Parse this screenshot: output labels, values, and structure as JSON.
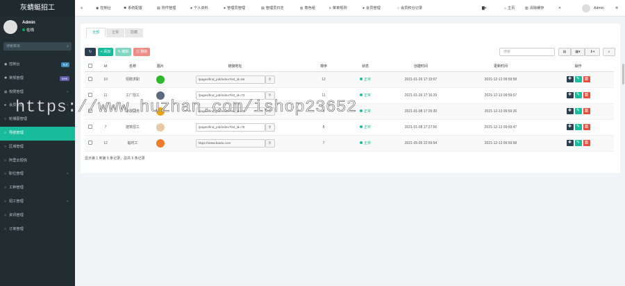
{
  "app": {
    "title": "灰蜻蜓招工"
  },
  "user": {
    "name": "Admin",
    "status": "在线"
  },
  "search": {
    "placeholder": "搜索菜单"
  },
  "sidebar": {
    "items": [
      {
        "label": "控制台",
        "icon": "dashboard-icon",
        "badge": "hot",
        "badge_color": "#3c8dbc"
      },
      {
        "label": "常规管理",
        "icon": "cogs-icon",
        "badge": "new",
        "badge_color": "#605ca8"
      },
      {
        "label": "权限管理",
        "icon": "group-icon",
        "arrow": "‹"
      },
      {
        "label": "会员管理",
        "icon": "user-icon",
        "arrow": "‹"
      },
      {
        "label": "轮播图管理",
        "icon": "image-icon"
      },
      {
        "label": "导航管理",
        "icon": "circle-icon",
        "active": true
      },
      {
        "label": "区域管理",
        "icon": "circle-icon"
      },
      {
        "label": "阿里云短信",
        "icon": "circle-icon"
      },
      {
        "label": "职位管理",
        "icon": "circle-icon",
        "arrow": "‹"
      },
      {
        "label": "工种管理",
        "icon": "circle-icon"
      },
      {
        "label": "招工管理",
        "icon": "circle-icon",
        "arrow": "‹"
      },
      {
        "label": "资讯管理",
        "icon": "circle-icon"
      },
      {
        "label": "订单管理",
        "icon": "circle-icon"
      }
    ]
  },
  "topnav": {
    "items": [
      {
        "label": "控制台",
        "icon": "dashboard-icon"
      },
      {
        "label": "系统配置",
        "icon": "cog-icon"
      },
      {
        "label": "附件管理",
        "icon": "file-icon"
      },
      {
        "label": "个人资料",
        "icon": "user-icon"
      },
      {
        "label": "管理员管理",
        "icon": "user-icon"
      },
      {
        "label": "管理员日志",
        "icon": "list-icon"
      },
      {
        "label": "角色组",
        "icon": "group-icon"
      },
      {
        "label": "菜单规则",
        "icon": "bars-icon"
      },
      {
        "label": "会员管理",
        "icon": "user-icon"
      },
      {
        "label": "会员积分记录",
        "icon": "circle-icon"
      }
    ],
    "right": {
      "home": "主页",
      "clear": "清除缓存",
      "admin": "Admin"
    }
  },
  "tabs": [
    "全部",
    "正常",
    "隐藏"
  ],
  "toolbar": {
    "add": "添加",
    "edit": "编辑",
    "delete": "删除",
    "search_placeholder": "搜索"
  },
  "table": {
    "headers": [
      "Id",
      "名称",
      "图片",
      "链接地址",
      "排序",
      "状态",
      "创建时间",
      "更新时间",
      "操作"
    ],
    "rows": [
      {
        "id": "10",
        "name": "招聘求职",
        "pic_color": "#2eb82e",
        "url": "/pages/find_job/index?list_id=55",
        "sort": "12",
        "status": "正常",
        "created": "2021-01-26 17:15:07",
        "updated": "2021-12-13 09:59:58"
      },
      {
        "id": "11",
        "name": "工厂招工",
        "pic_color": "#5a6b7d",
        "url": "/pages/find_job/index?list_id=73",
        "sort": "11",
        "status": "正常",
        "created": "2021-01-26 17:16:29",
        "updated": "2021-12-13 09:59:07"
      },
      {
        "id": "3",
        "name": "家政服务",
        "pic_color": "#e8a417",
        "url": "/pages/find_job/index?list_id=72",
        "sort": "9",
        "status": "正常",
        "created": "2021-01-08 17:26:30",
        "updated": "2021-12-13 09:59:26"
      },
      {
        "id": "7",
        "name": "建筑招工",
        "pic_color": "#e9c9a7",
        "url": "/pages/find_job/index?list_id=75",
        "sort": "8",
        "status": "正常",
        "created": "2021-01-08 17:27:56",
        "updated": "2021-12-13 09:59:47"
      },
      {
        "id": "12",
        "name": "临时工",
        "pic_color": "#f07d2e",
        "url": "https://www.baidu.com",
        "sort": "7",
        "status": "正常",
        "created": "2021-05-05 22:59:54",
        "updated": "2021-12-13 09:59:58"
      }
    ]
  },
  "footer": {
    "summary": "显示第 1 到第 5 条记录，总共 5 条记录"
  },
  "watermark": "https://www.huzhan.com/ishop23652",
  "colors": {
    "accent": "#18bc9c",
    "sidebar": "#222d32",
    "danger": "#e74c3c",
    "dark": "#2c3e50"
  }
}
